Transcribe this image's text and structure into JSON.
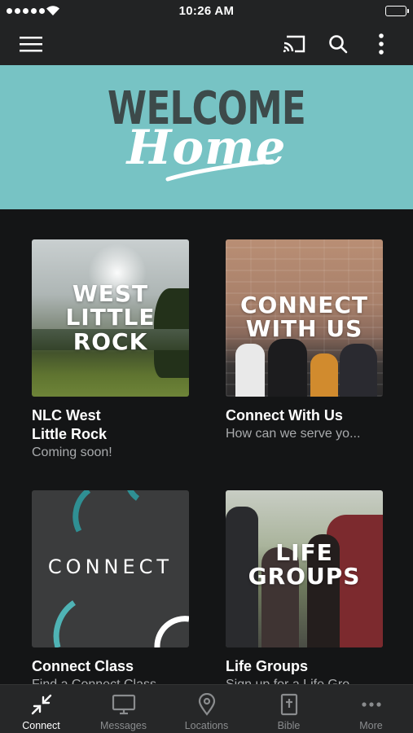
{
  "status_bar": {
    "time": "10:26 AM"
  },
  "app_bar": {
    "icons": [
      "menu-icon",
      "cast-icon",
      "search-icon",
      "more-vert-icon"
    ]
  },
  "hero": {
    "line1": "WELCOME",
    "line2": "Home"
  },
  "cards": [
    {
      "thumb_text": "WEST LITTLE ROCK",
      "thumb_lines": [
        "WEST",
        "LITTLE",
        "ROCK"
      ],
      "title": "NLC West Little Rock",
      "title_lines": [
        "NLC West",
        "Little Rock"
      ],
      "subtitle": "Coming soon!"
    },
    {
      "thumb_text": "CONNECT WITH US",
      "thumb_lines": [
        "CONNECT",
        "WITH US"
      ],
      "title": "Connect With Us",
      "subtitle": "How can we serve yo..."
    },
    {
      "thumb_text": "CONNECT",
      "thumb_lines": [
        "CONNECT"
      ],
      "title": "Connect Class",
      "subtitle": "Find a Connect Class..."
    },
    {
      "thumb_text": "LIFE GROUPS",
      "thumb_lines": [
        "LIFE",
        "GROUPS"
      ],
      "title": "Life Groups",
      "subtitle": "Sign up for a Life Gro..."
    }
  ],
  "tabs": [
    {
      "label": "Connect",
      "icon": "arrows-inward-icon",
      "active": true
    },
    {
      "label": "Messages",
      "icon": "monitor-icon",
      "active": false
    },
    {
      "label": "Locations",
      "icon": "map-pin-icon",
      "active": false
    },
    {
      "label": "Bible",
      "icon": "bible-icon",
      "active": false
    },
    {
      "label": "More",
      "icon": "more-horiz-icon",
      "active": false
    }
  ],
  "colors": {
    "hero": "#77c3c4",
    "background": "#141516",
    "bar": "#222324",
    "accent": "#4fb3b5"
  }
}
